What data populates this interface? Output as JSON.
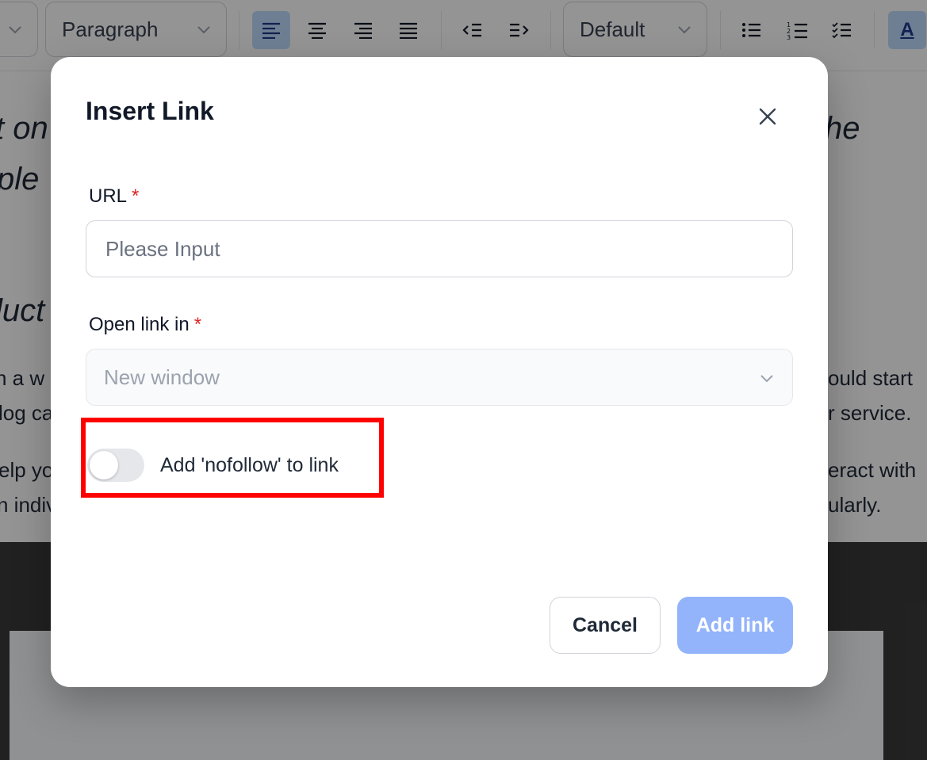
{
  "toolbar": {
    "block_type": "Paragraph",
    "font": "Default",
    "text_color_label": "A"
  },
  "content": {
    "line1_left": "t on",
    "line1_right": "he",
    "line2_left": "ple",
    "heading_left": "luct",
    "p1_left": "n a w",
    "p1_right": "ould start",
    "p2_left": "log ca",
    "p2_right": "r service.",
    "p3_left": "elp yo",
    "p3_right": "eract with",
    "p4_left": "n indiv",
    "p4_right": "ularly."
  },
  "modal": {
    "title": "Insert Link",
    "url_label": "URL",
    "required_mark": "*",
    "url_placeholder": "Please Input",
    "url_value": "",
    "open_label": "Open link in",
    "open_value": "New window",
    "nofollow_label": "Add 'nofollow' to link",
    "nofollow_enabled": false,
    "cancel_label": "Cancel",
    "add_label": "Add link"
  },
  "colors": {
    "accent": "#93b4fb",
    "highlight": "#ff0000",
    "required": "#dc2626"
  }
}
